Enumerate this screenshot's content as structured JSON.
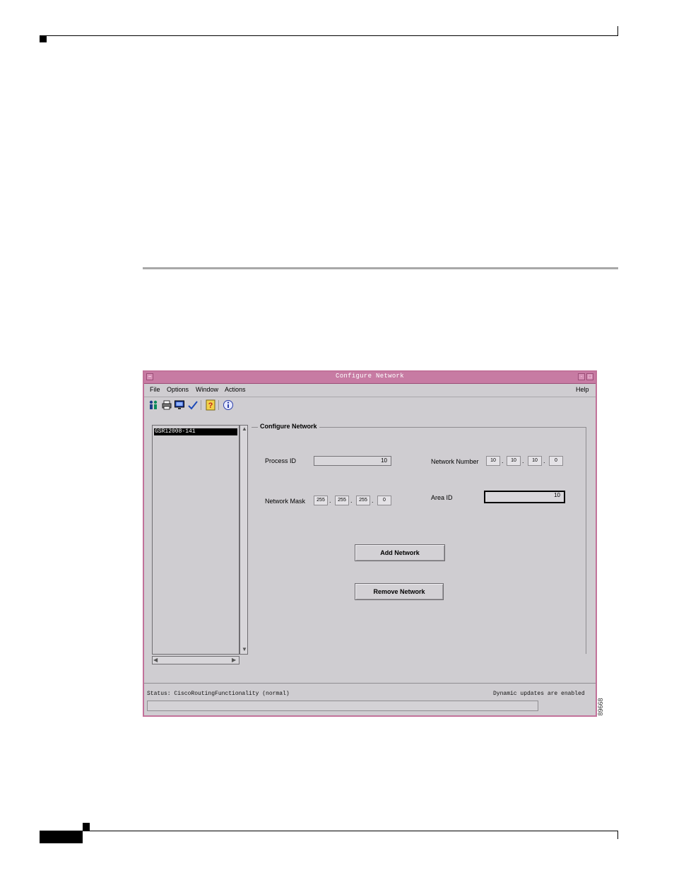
{
  "window": {
    "title": "Configure Network",
    "menu": [
      "File",
      "Options",
      "Window",
      "Actions"
    ],
    "help": "Help",
    "toolbar_icons": [
      "people-icon",
      "printer-icon",
      "monitor-icon",
      "checkmark-icon",
      "help-question-icon",
      "info-icon"
    ]
  },
  "tree": {
    "items": [
      "GSR12008-141"
    ]
  },
  "form": {
    "group_title": "Configure Network",
    "process_id_label": "Process ID",
    "process_id_value": "10",
    "network_number_label": "Network Number",
    "network_number": [
      "10",
      "10",
      "10",
      "0"
    ],
    "network_mask_label": "Network Mask",
    "network_mask": [
      "255",
      "255",
      "255",
      "0"
    ],
    "area_id_label": "Area ID",
    "area_id_value": "10",
    "add_button": "Add Network",
    "remove_button": "Remove Network"
  },
  "status": {
    "left": "Status: CiscoRoutingFunctionality (normal)",
    "right": "Dynamic updates are enabled"
  },
  "figure_number": "89668",
  "colors": {
    "titlebar": "#c77ba3",
    "window_bg": "#cfcdd1",
    "section_rule": "#a8a8a8"
  }
}
